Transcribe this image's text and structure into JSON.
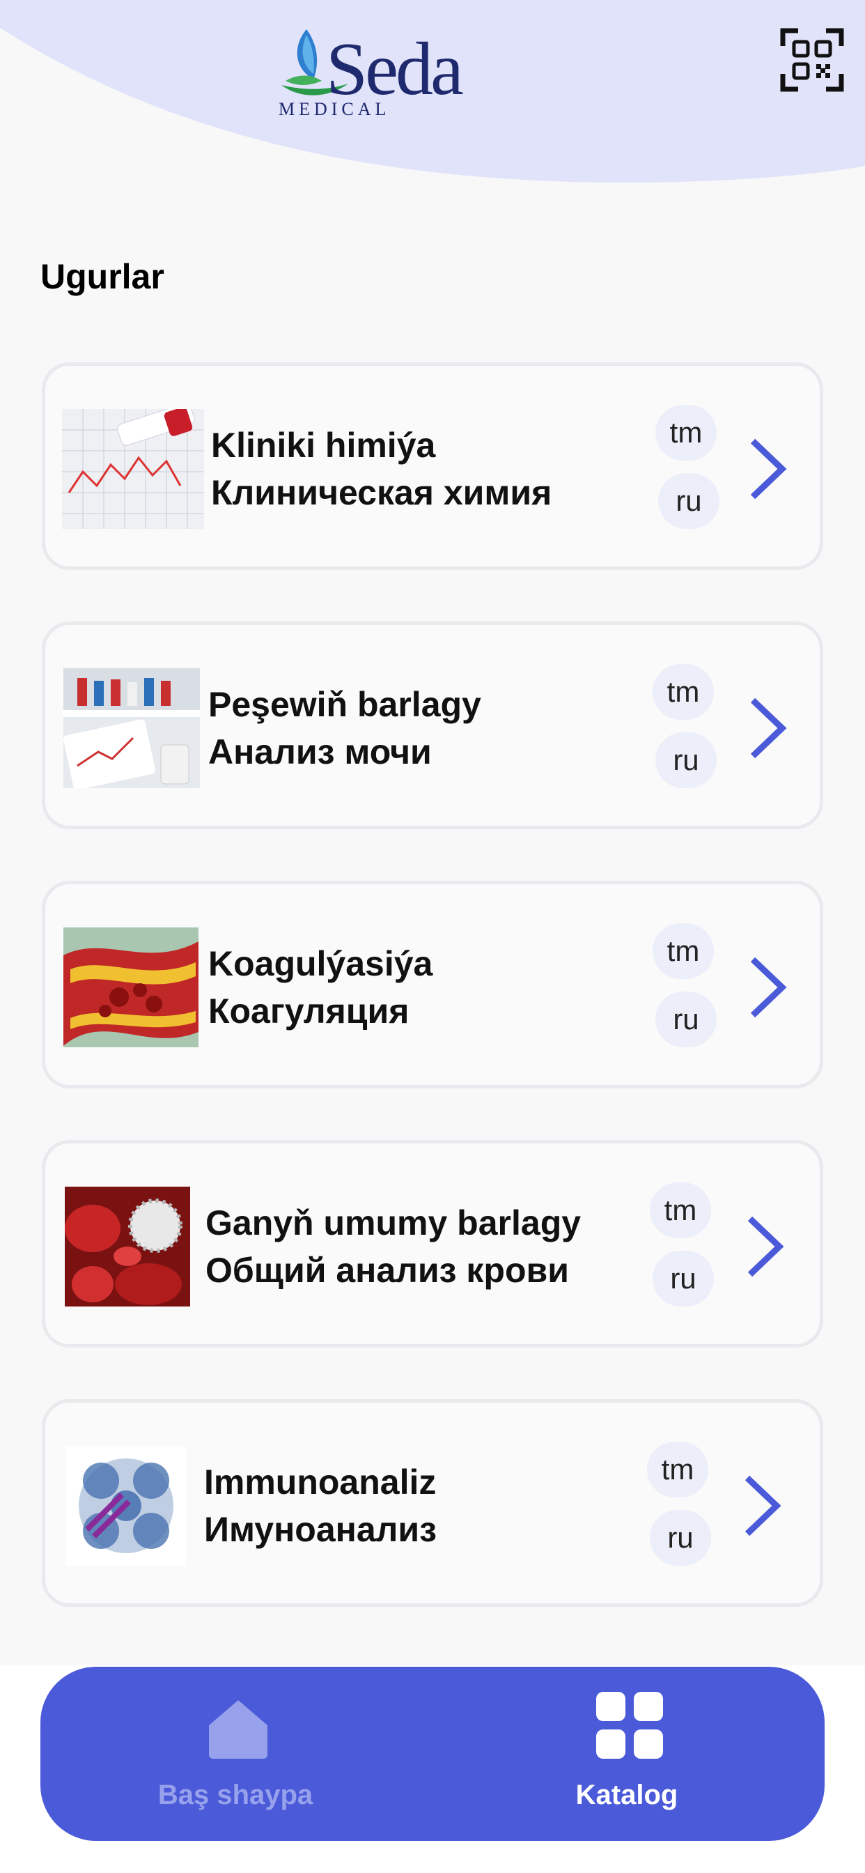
{
  "header": {
    "logo_word": "Seda",
    "logo_sub": "MEDICAL",
    "qr_icon": "qr-code-icon",
    "bg_color": "#e1e3fa"
  },
  "section_title": "Ugurlar",
  "categories": [
    {
      "name_tm": "Kliniki himiýa",
      "name_ru": "Клиническая химия",
      "lang_tm": "tm",
      "lang_ru": "ru",
      "image": "clinical-chemistry-image"
    },
    {
      "name_tm": "Peşewiň barlagy",
      "name_ru": "Анализ мочи",
      "lang_tm": "tm",
      "lang_ru": "ru",
      "image": "urine-analysis-image"
    },
    {
      "name_tm": "Koagulýasiýa",
      "name_ru": "Коагуляция",
      "lang_tm": "tm",
      "lang_ru": "ru",
      "image": "coagulation-image"
    },
    {
      "name_tm": "Ganyň umumy barlagy",
      "name_ru": "Общий анализ крови",
      "lang_tm": "tm",
      "lang_ru": "ru",
      "image": "blood-analysis-image"
    },
    {
      "name_tm": "Immunoanaliz",
      "name_ru": "Имуноанализ",
      "lang_tm": "tm",
      "lang_ru": "ru",
      "image": "immunoassay-image"
    }
  ],
  "bottom_nav": {
    "home_label": "Baş shaypa",
    "catalog_label": "Katalog",
    "active": "catalog",
    "accent": "#4a5ad8"
  }
}
